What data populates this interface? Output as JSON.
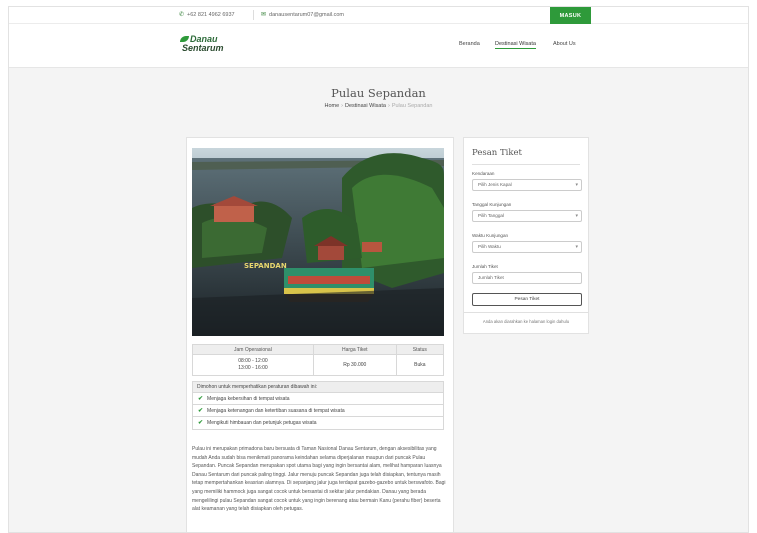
{
  "topbar": {
    "phone": "+62 821 4962 6937",
    "email": "danausentarum07@gmail.com",
    "login_label": "MASUK"
  },
  "brand": {
    "line1": "Danau",
    "line2": "Sentarum"
  },
  "nav": {
    "items": [
      "Beranda",
      "Destinasi Wisata",
      "About Us"
    ]
  },
  "page": {
    "title": "Pulau Sepandan",
    "breadcrumb": [
      "Home",
      "Destinasi Wisata",
      "Pulau Sepandan"
    ]
  },
  "photo": {
    "sign_text": "SEPANDAN"
  },
  "info_table": {
    "headers": [
      "Jam Operasional",
      "Harga Tiket",
      "Status"
    ],
    "hours": [
      "08:00 - 12:00",
      "13:00 - 16:00"
    ],
    "price": "Rp 30.000",
    "status": "Buka"
  },
  "rules": {
    "intro": "Dimohon untuk memperhatikan peraturan dibawah ini:",
    "items": [
      "Menjaga kebersihan di tempat wisata",
      "Menjaga ketenangan dan ketertiban suasana di tempat wisata",
      "Mengikuti himbauan dan petunjuk petugas wisata"
    ]
  },
  "description": "Pulau ini merupakan primadona baru bersuata di Taman Nasional Danau Sentarum, dengan aksesibilitas yang mudah Anda sudah bisa menikmati panorama keindahan selama diperjalanan maupun dari puncak Pulau Sepandan. Puncak Sepandan merupakan spot utama bagi yang ingin bersantai alam, melihat hamparan luasnya Danau Sentarum dari puncak paling tinggi. Jalur menuju puncak Sepandan juga telah disiapkan, tentunya masih tetap mempertahankan keasrian alamnya. Di sepanjang jalur juga terdapat gazebo-gazebo untuk berswafoto. Bagi yang memiliki hammock juga sangat cocok untuk bersantai di sekitar jalur pendakian. Danau yang berada mengelilingi pulau Sepandan sangat cocok untuk yang ingin berenang atau bermain Kanu (perahu fiber) beserta alat keamanan yang telah disiapkan oleh petugas.",
  "booking": {
    "title": "Pesan Tiket",
    "kendaraan_label": "Kendaraan",
    "kendaraan_value": "Pilih Jenis Kapal",
    "tanggal_label": "Tanggal Kunjungan",
    "tanggal_value": "Pilih Tanggal",
    "waktu_label": "Waktu Kunjungan",
    "waktu_value": "Pilih Waktu",
    "jumlah_label": "Jumlah Tiket",
    "jumlah_placeholder": "Jumlah Tiket",
    "submit_label": "Pesan Tiket",
    "note": "Anda akan diarahkan ke halaman login dahulu"
  },
  "colors": {
    "accent": "#2e9a3a",
    "brand_dark": "#2b4b2f"
  }
}
